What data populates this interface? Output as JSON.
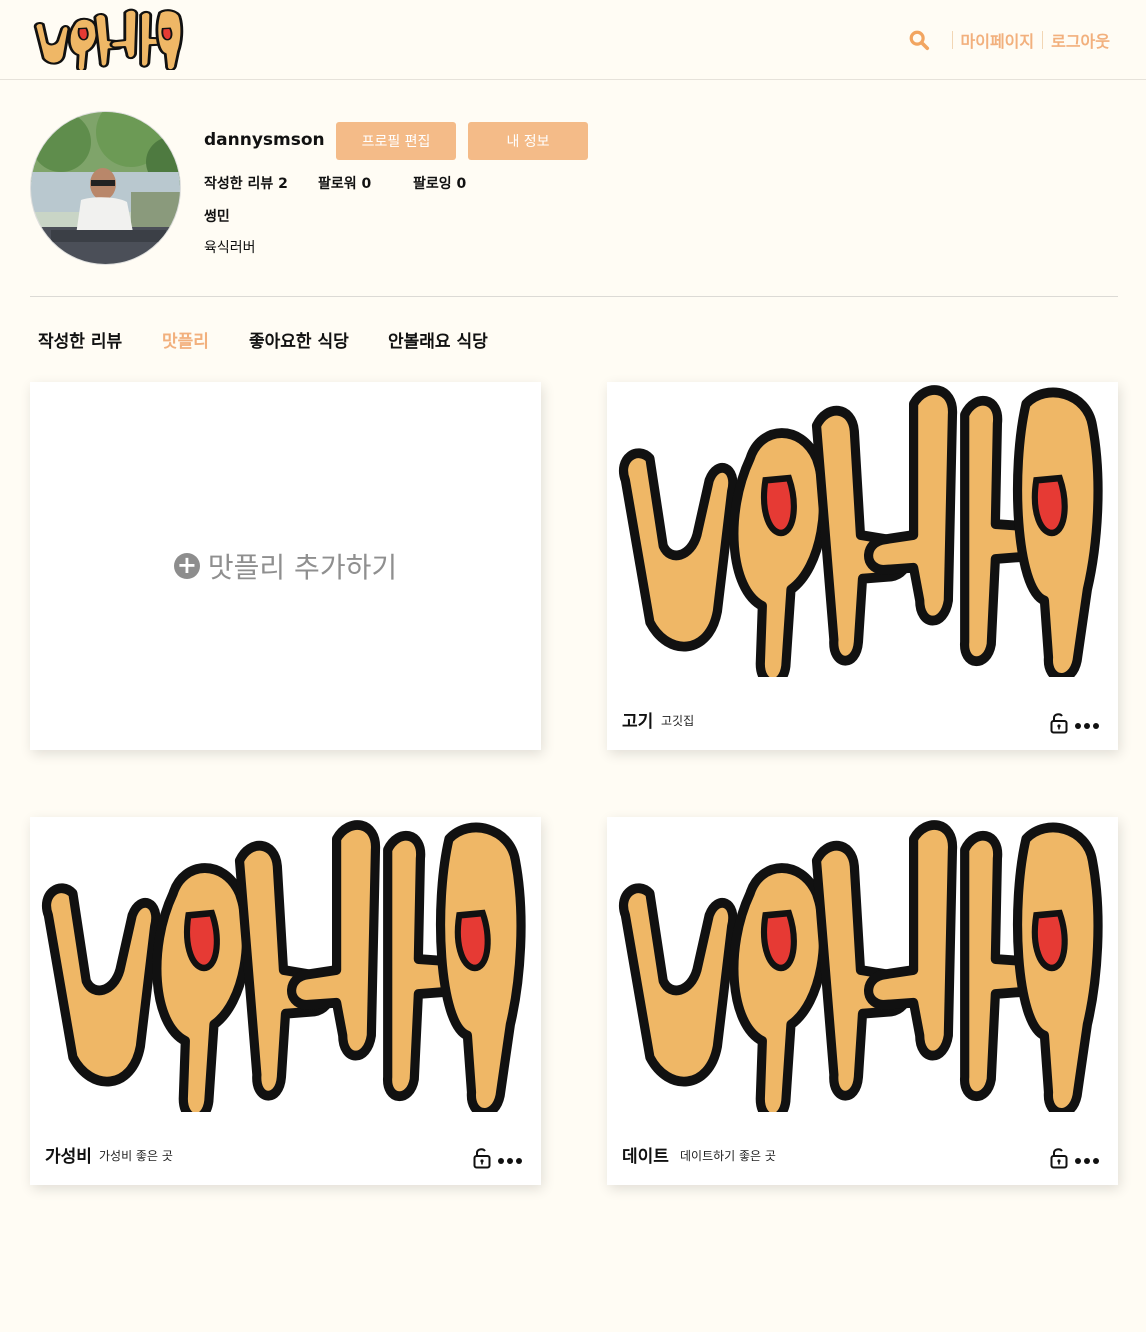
{
  "header": {
    "logo_text": "니맛내맛",
    "nav": {
      "search_icon": "search-icon",
      "mypage": "마이페이지",
      "logout": "로그아웃"
    }
  },
  "profile": {
    "username": "dannysmson",
    "buttons": {
      "edit": "프로필 편집",
      "info": "내 정보"
    },
    "stats": {
      "reviews": "작성한 리뷰 2",
      "followers": "팔로워 0",
      "following": "팔로잉 0"
    },
    "nickname": "썽민",
    "bio": "육식러버"
  },
  "tabs": [
    {
      "label": "작성한 리뷰",
      "active": false
    },
    {
      "label": "맛플리",
      "active": true
    },
    {
      "label": "좋아요한 식당",
      "active": false
    },
    {
      "label": "안볼래요 식당",
      "active": false
    }
  ],
  "add_card": {
    "label": "맛플리 추가하기"
  },
  "playlists": [
    {
      "title": "고기",
      "description": "고깃집"
    },
    {
      "title": "가성비",
      "description": "가성비 좋은 곳"
    },
    {
      "title": "데이트",
      "description": "데이트하기 좋은 곳"
    }
  ],
  "colors": {
    "accent": "#f2b07d",
    "button": "#f4bb88",
    "logo_fill": "#efb766",
    "tongue": "#e63a34"
  }
}
